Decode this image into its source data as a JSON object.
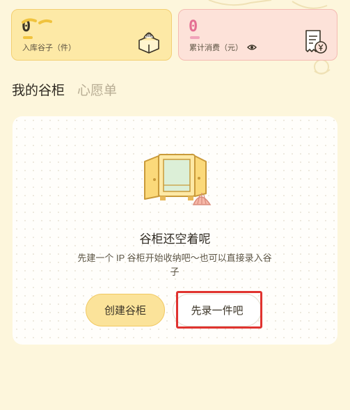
{
  "stats": [
    {
      "value": "0",
      "label": "入库谷子（件）",
      "icon": "box-with-shell-icon",
      "accent": "#f0c33e"
    },
    {
      "value": "0",
      "label": "累计消费（元）",
      "icon": "receipt-yen-icon",
      "accent": "#e46f93",
      "toggle_icon": "eye-icon"
    }
  ],
  "tabs": [
    {
      "label": "我的谷柜",
      "active": true
    },
    {
      "label": "心愿单",
      "active": false
    }
  ],
  "empty_state": {
    "illustration": "open-cabinet-with-shell-icon",
    "title": "谷柜还空着呢",
    "description": "先建一个 IP 谷柜开始收纳吧～也可以直接录入谷子"
  },
  "actions": {
    "create_label": "创建谷柜",
    "record_label": "先录一件吧"
  },
  "colors": {
    "background": "#fdf6dc",
    "yellow_card": "#fde9a6",
    "pink_card": "#fde2d9",
    "primary_button": "#fbe39a",
    "highlight": "#e0332f"
  }
}
